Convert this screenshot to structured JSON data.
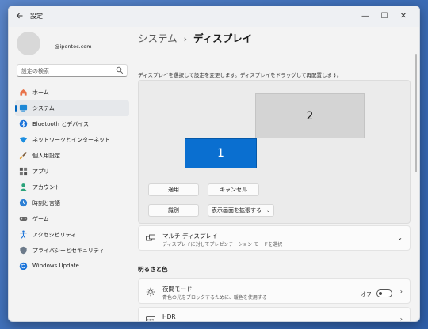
{
  "titlebar": {
    "app_title": "設定",
    "back_icon": "arrow-left-icon",
    "minimize": "—",
    "maximize": "☐",
    "close": "✕"
  },
  "account": {
    "email": "@ipentec.com"
  },
  "search": {
    "placeholder": "設定の検索"
  },
  "nav": {
    "items": [
      {
        "label": "ホーム",
        "icon": "home-icon"
      },
      {
        "label": "システム",
        "icon": "display-icon",
        "active": true
      },
      {
        "label": "Bluetooth とデバイス",
        "icon": "bluetooth-icon"
      },
      {
        "label": "ネットワークとインターネット",
        "icon": "wifi-icon"
      },
      {
        "label": "個人用設定",
        "icon": "brush-icon"
      },
      {
        "label": "アプリ",
        "icon": "apps-icon"
      },
      {
        "label": "アカウント",
        "icon": "person-icon"
      },
      {
        "label": "時刻と言語",
        "icon": "globe-clock-icon"
      },
      {
        "label": "ゲーム",
        "icon": "gamepad-icon"
      },
      {
        "label": "アクセシビリティ",
        "icon": "accessibility-icon"
      },
      {
        "label": "プライバシーとセキュリティ",
        "icon": "shield-icon"
      },
      {
        "label": "Windows Update",
        "icon": "update-icon"
      }
    ]
  },
  "breadcrumb": {
    "parent": "システム",
    "separator": "›",
    "current": "ディスプレイ"
  },
  "arrange": {
    "instruction": "ディスプレイを選択して設定を変更します。ディスプレイをドラッグして再配置します。",
    "monitor_1": "1",
    "monitor_2": "2",
    "apply_label": "適用",
    "cancel_label": "キャンセル",
    "identify_label": "識別",
    "mode_value": "表示画面を拡張する"
  },
  "multi_display": {
    "title": "マルチ ディスプレイ",
    "description": "ディスプレイに対してプレゼンテーション モードを選択"
  },
  "brightness_section": {
    "heading": "明るさと色"
  },
  "night_light": {
    "title": "夜間モード",
    "description": "青色の光をブロックするために、暖色を使用する",
    "state_label": "オフ",
    "enabled": false
  },
  "hdr": {
    "title": "HDR"
  },
  "colors": {
    "accent": "#0067c0",
    "monitor_selected": "#0a6fd0"
  }
}
